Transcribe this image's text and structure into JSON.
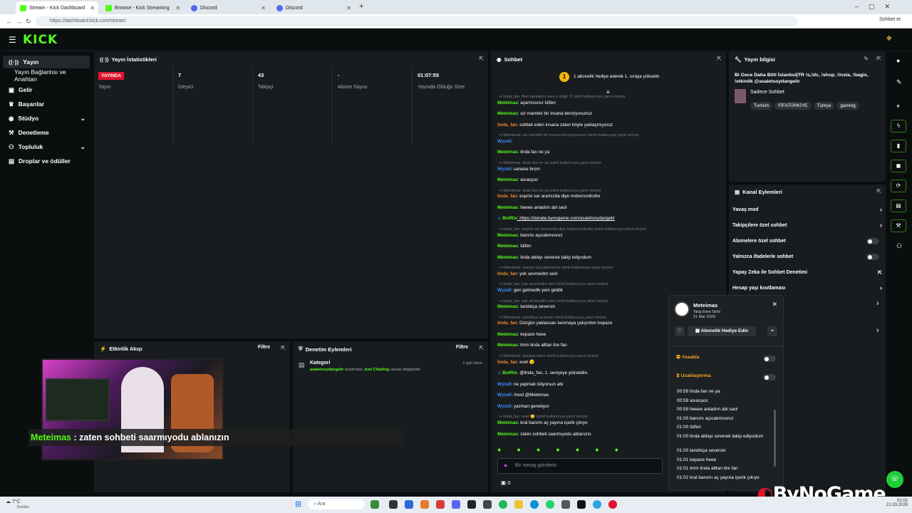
{
  "browser": {
    "tabs": [
      {
        "title": "Stream - Kick Dashboard",
        "color": "#53fc18"
      },
      {
        "title": "Browse - Kick Streaming",
        "color": "#53fc18"
      },
      {
        "title": "Discord",
        "color": "#5865f2"
      },
      {
        "title": "Discord",
        "color": "#5865f2"
      }
    ],
    "new_tab": "+",
    "url": "https://dashboard.kick.com/stream",
    "profile": "Sohbet et"
  },
  "header": {
    "logo": "KICK"
  },
  "sidebar": {
    "items": [
      {
        "label": "Yayın",
        "icon": "stream-icon"
      },
      {
        "label": "Yayın Bağlantısı ve Anahtarı",
        "icon": ""
      },
      {
        "label": "Gelir",
        "icon": "wallet-icon"
      },
      {
        "label": "Başarılar",
        "icon": "trophy-icon"
      },
      {
        "label": "Stüdyo",
        "icon": "studio-icon"
      },
      {
        "label": "Denetleme",
        "icon": "hammer-icon"
      },
      {
        "label": "Topluluk",
        "icon": "community-icon"
      },
      {
        "label": "Droplar ve ödüller",
        "icon": "gift-icon"
      }
    ]
  },
  "stats": {
    "title": "Yayın İstatistikleri",
    "live_badge": "YAYINDA",
    "live_label": "Yayın",
    "viewers_value": "7",
    "viewers_label": "İzleyici",
    "followers_value": "43",
    "followers_label": "Takipçi",
    "subs_value": "-",
    "subs_label": "Abone Sayısı",
    "duration_value": "01:07:55",
    "duration_label": "Yayında Olduğu Süre"
  },
  "activity": {
    "title": "Etkinlik Akışı",
    "filter": "Filtre"
  },
  "moderation": {
    "title": "Denetim Eylemleri",
    "filter": "Filtre",
    "entry_title": "Kategori",
    "entry_user": "asaletsoydangelir",
    "entry_mid": "tarafından",
    "entry_cat": "Just Chatting",
    "entry_rest": "olarak değiştirildi",
    "entry_time": "1 gün önce"
  },
  "overlay": {
    "user": "Meteimas",
    "sep": ":",
    "text": "zaten sohbeti saarmıyodu ablanızın"
  },
  "chat": {
    "title": "Sohbet",
    "banner": "1 abonelik hediye ederek 1. sıraya yükselin",
    "banner_rank": "1",
    "lines": [
      {
        "type": "reply",
        "text": "linda_fan: Ben banladım seni o degil :D isimli kullanıcıya yanıt veriyor"
      },
      {
        "type": "msg",
        "user": "Meteimas",
        "cls": "mod",
        "text": ": açarmısınız lütfen"
      },
      {
        "type": "msg",
        "user": "Meteimas",
        "cls": "mod",
        "text": ": siz mantıklı bir insana benziyosunuz"
      },
      {
        "type": "msg",
        "user": "linda_fan",
        "cls": "lin",
        "text": ": sohbet eden insana zaten böyle yaklaşmıyoruz"
      },
      {
        "type": "reply",
        "text": "Meteimas: siz mantıklı bir insana benziyosunuz isimli kullanıcıya yanıt veriyor"
      },
      {
        "type": "msg",
        "user": "Wyzell",
        "cls": "wyz",
        "text": ":"
      },
      {
        "type": "msg",
        "user": "Meteimas",
        "cls": "mod",
        "text": ": linda fan ne ya"
      },
      {
        "type": "reply",
        "text": "Meteimas: linda fan ne ya isimli kullanıcıya yanıt veriyor"
      },
      {
        "type": "msg",
        "user": "Wyzell",
        "cls": "wyz",
        "text": ": sanane brom"
      },
      {
        "type": "msg",
        "user": "Meteimas",
        "cls": "mod",
        "text": ": asıasşoc"
      },
      {
        "type": "reply",
        "text": "Meteimas: linda fan ne ya isimli kullanıcıya yanıt veriyor"
      },
      {
        "type": "msg",
        "user": "linda_fan",
        "cls": "lin",
        "text": ": esprisi var aramızda diye msbxnzvdnzbx"
      },
      {
        "type": "msg",
        "user": "Meteimas",
        "cls": "mod",
        "text": ": heeee anladım abi saol"
      },
      {
        "type": "msg",
        "user": "BotRix",
        "cls": "bot",
        "text": ": https://donate.bynogame.com/asaletsoydangelir"
      },
      {
        "type": "reply",
        "text": "linda_fan: esprisi var aramızda diye msbxnzvdnzbx isimli kullanıcıya yanıt veriyor"
      },
      {
        "type": "msg",
        "user": "Meteimas",
        "cls": "mod",
        "text": ": banımı açıcakmısınız"
      },
      {
        "type": "msg",
        "user": "Meteimas",
        "cls": "mod",
        "text": ": lütfen"
      },
      {
        "type": "msg",
        "user": "Meteimas",
        "cls": "mod",
        "text": ": linda ablayı severek takip ediyodum"
      },
      {
        "type": "reply",
        "text": "Meteimas: banımı açıcakmısınız isimli kullanıcıya yanıt veriyor"
      },
      {
        "type": "msg",
        "user": "linda_fan",
        "cls": "lin",
        "text": ": yok sevmedim seni"
      },
      {
        "type": "reply",
        "text": "linda_fan: yok sevmedim seni isimli kullanıcıya yanıt veriyor"
      },
      {
        "type": "msg",
        "user": "Wyzell",
        "cls": "wyz",
        "text": ": geri gelmedik yeni geldik"
      },
      {
        "type": "reply",
        "text": "linda_fan: yok sevmedim seni isimli kullanıcıya yanıt veriyor"
      },
      {
        "type": "msg",
        "user": "Meteimas",
        "cls": "mod",
        "text": ": tandıkça seversin"
      },
      {
        "type": "reply",
        "text": "Meteimas: tandıkça seversin isimli kullanıcıya yanıt veriyor"
      },
      {
        "type": "msg",
        "user": "linda_fan",
        "cls": "lin",
        "text": ": Düzgün yaklassan tanımaya çalışırdım kepaze"
      },
      {
        "type": "msg",
        "user": "Meteimas",
        "cls": "mod",
        "text": ": kepaze heee"
      },
      {
        "type": "msg",
        "user": "Meteimas",
        "cls": "mod",
        "text": ": tmm linda alttan tire fan"
      },
      {
        "type": "reply",
        "text": "Meteimas: kepaze heee isimli kullanıcıya yanıt veriyor"
      },
      {
        "type": "msg",
        "user": "linda_fan",
        "cls": "lin",
        "text": ": evet 😏"
      },
      {
        "type": "msg",
        "user": "BotRix",
        "cls": "bot",
        "text": ": @linda_fan, 1. seviyeye yükseldin."
      },
      {
        "type": "msg",
        "user": "Wyzell",
        "cls": "wyz",
        "text": ": ne yapmak istiyorsun abi"
      },
      {
        "type": "msg",
        "user": "Wyzell",
        "cls": "wyz",
        "text": ": /mod @Meteimas"
      },
      {
        "type": "msg",
        "user": "Wyzell",
        "cls": "wyz",
        "text": ": yazman gerekiyor"
      },
      {
        "type": "reply",
        "text": "linda_fan: evet 😏 isimli kullanıcıya yanıt veriyor"
      },
      {
        "type": "msg",
        "user": "Meteimas",
        "cls": "mod",
        "text": ": kral banımı aç yayına içerik çıkıyo"
      },
      {
        "type": "msg",
        "user": "Meteimas",
        "cls": "mod",
        "text": ": zaten sohbeti saarmıyodu ablanızın"
      }
    ],
    "input_placeholder": "Bir mesaj gönderin",
    "points": "0"
  },
  "stream_info": {
    "title": "Yayın bilgisi",
    "stream_title": "Bi Gece Daha Bitti İstanbul|TR !s,!dc, !shop, !insta, !bagis, !etkinlik @asaletsoydangelir",
    "category": "Sadece Sohbet",
    "tags": [
      "Turkish",
      "FİFATÜRKİYE",
      "Türkçe",
      "gaming"
    ]
  },
  "channel_actions": {
    "title": "Kanal Eylemleri",
    "items": [
      {
        "label": "Yavaş mod",
        "kind": "arrow"
      },
      {
        "label": "Takipçilere özel sohbet",
        "kind": "arrow"
      },
      {
        "label": "Abonelere özel sohbet",
        "kind": "toggle"
      },
      {
        "label": "Yalnızca ifadelerle sohbet",
        "kind": "toggle"
      },
      {
        "label": "Yapay Zeka ile Sohbet Denetimi",
        "kind": "link"
      },
      {
        "label": "Hesap yaşı kısıtlaması",
        "kind": "arrow"
      }
    ]
  },
  "user_card": {
    "name": "Meteimas",
    "follow_label": "Takip Etme Tarihi",
    "follow_date": "21 Mar 2026",
    "gift_button": "Abonelik Hediye Edin",
    "ban_label": "Yasakla",
    "timeout_label": "Uzaklaştırma",
    "history": [
      "00:59 linda fan ne ya",
      "00:59 asıasşoc",
      "00:59 heeee anladım abi saol",
      "01:00 banımı açıcakmısınız",
      "01:00 lütfen",
      "01:00 linda ablayı severek takip ediyodum",
      "01:00 tandıkça seversin",
      "01:01 kepaze heee",
      "01:01 tmm linda alttan tire fan",
      "01:02 kral banımı aç yayına içerik çıkıyo"
    ]
  },
  "taskbar": {
    "weather_temp": "7°C",
    "weather_desc": "Bulutlu",
    "search": "Ara",
    "time": "01:02",
    "date": "21.03.2026"
  },
  "watermark": "ByNoGame"
}
